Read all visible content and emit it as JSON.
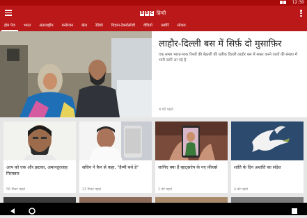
{
  "status": {
    "time": "12:30"
  },
  "app": {
    "logo_letters": [
      "B",
      "B",
      "C"
    ],
    "logo_suffix": "हिन्दी"
  },
  "tabs": [
    {
      "label": "होम पेज",
      "active": true
    },
    {
      "label": "भारत"
    },
    {
      "label": "अंतरराष्ट्रीय"
    },
    {
      "label": "मनोरंजन"
    },
    {
      "label": "खेल"
    },
    {
      "label": "रेडियो"
    },
    {
      "label": "विज्ञान-टेक्नॉलॉजी"
    },
    {
      "label": "वीडियो"
    },
    {
      "label": "तस्वीरें"
    },
    {
      "label": "सोशल"
    }
  ],
  "hero": {
    "title": "लाहौर-दिल्ली बस में सिर्फ़ दो मुसाफ़िर",
    "summary": "एक समय भारत-पाक रिश्तों की बेहतरी की प्रतीक दिल्ली लाहौर बस में सफ़र करने वालों की संख्या में भारी कमी आ गई है.",
    "time": "4 घंटे पहले"
  },
  "cards": [
    {
      "title": "आप को एक और झटका, अमानतुल्लाह गिरफ़्तार",
      "time": "56 मिनट पहले"
    },
    {
      "title": "सचिन ने फ़ैन से कहा, \"हैप्पी बर्थ डे\"",
      "time": "23 मिनट पहले"
    },
    {
      "title": "जानिए क्या हैं व्हाट्सऐप के नए फ़ीचर्स",
      "time": "2 घंटे पहले"
    },
    {
      "title": "शांति के दिन अशांति का संदेश",
      "time": "4 घंटे पहले"
    }
  ],
  "colors": {
    "brand_red": "#bb1919",
    "status_red": "#a80a0a"
  },
  "icons": [
    "hamburger-menu-icon",
    "overflow-menu-icon",
    "back-icon",
    "home-icon",
    "recents-icon"
  ]
}
